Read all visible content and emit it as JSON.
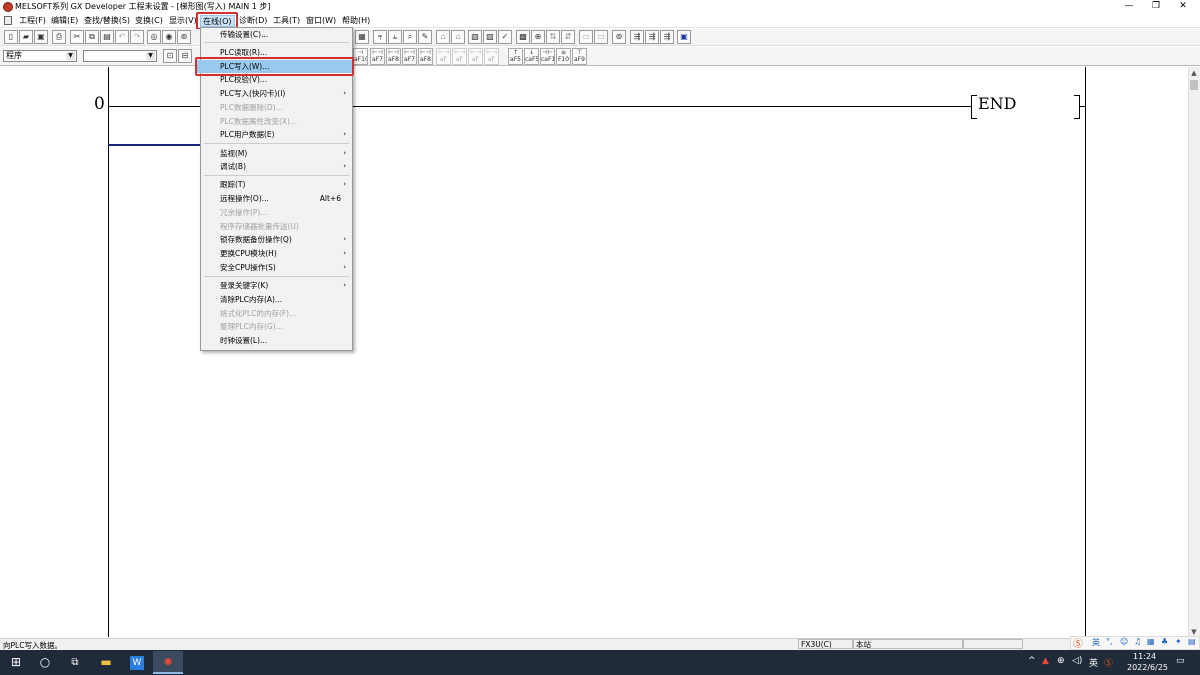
{
  "window": {
    "title": "MELSOFT系列 GX Developer 工程未设置 - [梯形图(写入)    MAIN    1 步]",
    "controls": [
      "—",
      "❐",
      "✕"
    ]
  },
  "menubar": {
    "items": [
      "工程(F)",
      "编辑(E)",
      "查找/替换(S)",
      "变换(C)",
      "显示(V)",
      "在线(O)",
      "诊断(D)",
      "工具(T)",
      "窗口(W)",
      "帮助(H)"
    ],
    "active": "在线(O)"
  },
  "toolbar": {
    "program_select": "程序",
    "buttons_row2": [
      "aF10",
      "aF7",
      "aF8",
      "aF7",
      "aF8",
      "aF5",
      "caF5",
      "caF10",
      "aF5",
      "caF5",
      "caF10",
      "F10"
    ]
  },
  "ladder": {
    "step_number": "0",
    "end_instruction": "END"
  },
  "online_menu": {
    "items": [
      {
        "label": "传输设置(C)...",
        "disabled": false,
        "submenu": false
      },
      {
        "label": "PLC读取(R)...",
        "disabled": false,
        "submenu": false
      },
      {
        "label": "PLC写入(W)...",
        "disabled": false,
        "submenu": false,
        "selected": true
      },
      {
        "label": "PLC校验(V)...",
        "disabled": false,
        "submenu": false
      },
      {
        "label": "PLC写入(快闪卡)(I)",
        "disabled": false,
        "submenu": true
      },
      {
        "label": "PLC数据删除(D)...",
        "disabled": true,
        "submenu": false
      },
      {
        "label": "PLC数据属性改变(X)...",
        "disabled": true,
        "submenu": false
      },
      {
        "label": "PLC用户数据(E)",
        "disabled": false,
        "submenu": true
      },
      {
        "label": "监视(M)",
        "disabled": false,
        "submenu": true
      },
      {
        "label": "调试(B)",
        "disabled": false,
        "submenu": true
      },
      {
        "label": "跟踪(T)",
        "disabled": false,
        "submenu": true
      },
      {
        "label": "远程操作(O)...",
        "disabled": false,
        "submenu": false,
        "shortcut": "Alt+6"
      },
      {
        "label": "冗余操作(P)...",
        "disabled": true,
        "submenu": false
      },
      {
        "label": "程序存储器批量传送(U)",
        "disabled": true,
        "submenu": false
      },
      {
        "label": "锁存数据备份操作(Q)",
        "disabled": false,
        "submenu": true
      },
      {
        "label": "更换CPU模块(H)",
        "disabled": false,
        "submenu": true
      },
      {
        "label": "安全CPU操作(S)",
        "disabled": false,
        "submenu": true
      },
      {
        "label": "登录关键字(K)",
        "disabled": false,
        "submenu": true
      },
      {
        "label": "清除PLC内存(A)...",
        "disabled": false,
        "submenu": false
      },
      {
        "label": "格式化PLC的内存(F)...",
        "disabled": true,
        "submenu": false
      },
      {
        "label": "整理PLC内存(G)...",
        "disabled": true,
        "submenu": false
      },
      {
        "label": "时钟设置(L)...",
        "disabled": false,
        "submenu": false
      }
    ]
  },
  "statusbar": {
    "message": "向PLC写入数据。",
    "cpu": "FX3U(C)",
    "station": "本站"
  },
  "taskbar": {
    "time": "11:24",
    "date": "2022/6/25",
    "ime_lang": "英",
    "colors": {
      "taskbar": "#1f2b3a",
      "highlight": "#d32f2f",
      "selection": "#99c9ef"
    }
  }
}
